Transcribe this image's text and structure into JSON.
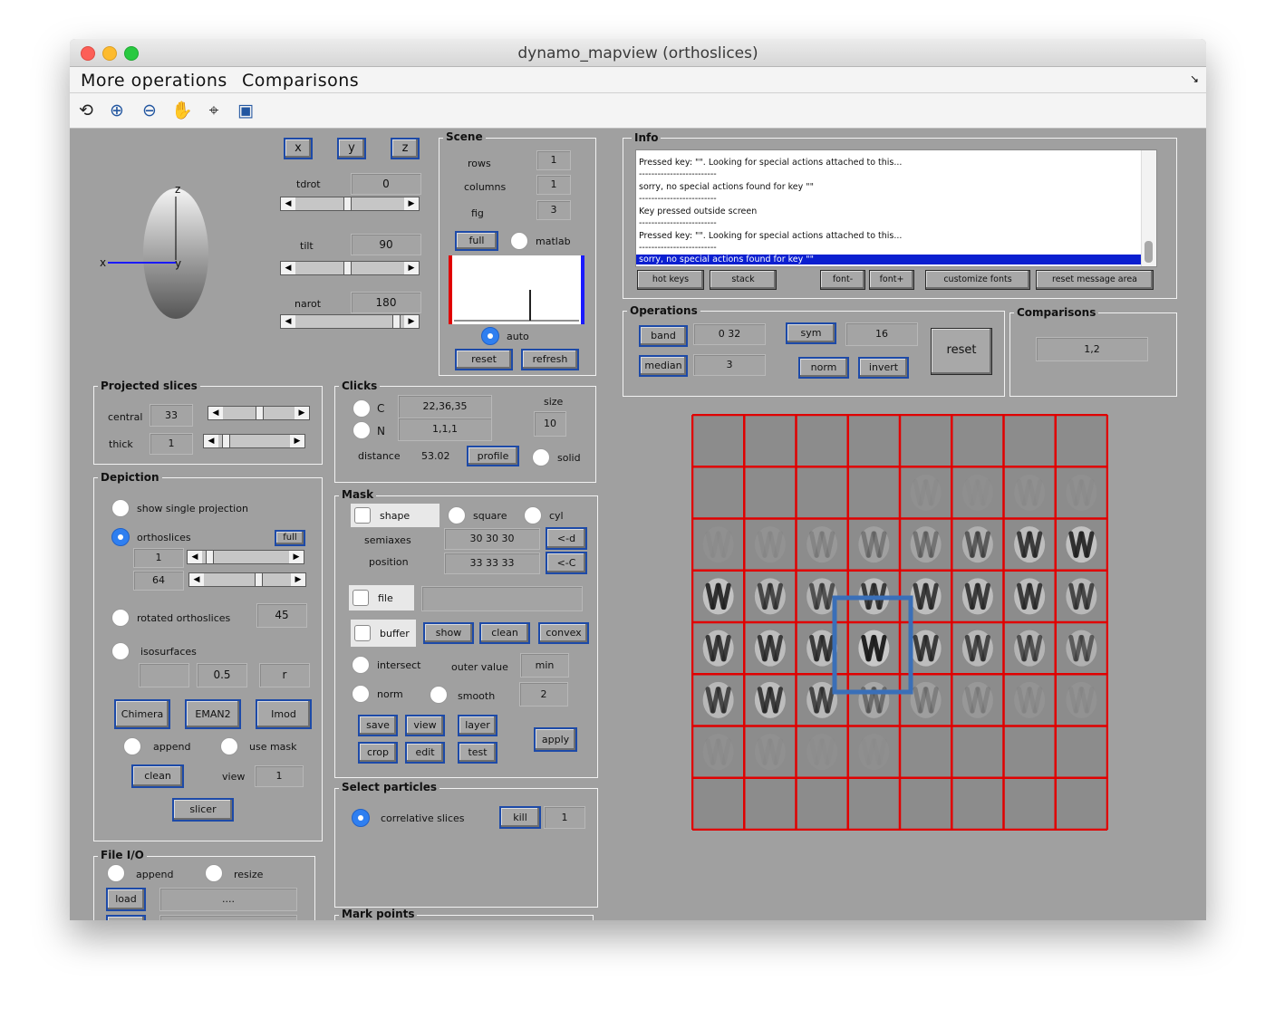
{
  "window": {
    "title": "dynamo_mapview (orthoslices)"
  },
  "menu": {
    "items": [
      "More operations",
      "Comparisons"
    ]
  },
  "toolbar": {
    "icons": [
      "rotate-3d-icon",
      "zoom-in-icon",
      "zoom-out-icon",
      "pan-hand-icon",
      "data-cursor-icon",
      "save-icon"
    ]
  },
  "axes_buttons": {
    "x": "x",
    "y": "y",
    "z": "z"
  },
  "orientation": {
    "z_label": "z",
    "x_label": "x",
    "y_label": "y",
    "tdrot": {
      "label": "tdrot",
      "value": "0",
      "slider": 0.5
    },
    "tilt": {
      "label": "tilt",
      "value": "90",
      "slider": 0.5
    },
    "narot": {
      "label": "narot",
      "value": "180",
      "slider": 1.0
    }
  },
  "scene": {
    "title": "Scene",
    "rows_label": "rows",
    "rows": "1",
    "columns_label": "columns",
    "columns": "1",
    "fig_label": "fig",
    "fig": "3",
    "full": "full",
    "matlab": "matlab",
    "auto": "auto",
    "reset": "reset",
    "refresh": "refresh"
  },
  "info": {
    "title": "Info",
    "lines": [
      "Pressed key: \"\".  Looking for special actions attached to this...",
      "-------------------------",
      "sorry, no special actions found for key \"\"",
      "-------------------------",
      "Key pressed outside screen",
      "-------------------------",
      "Pressed key: \"\".  Looking for special actions attached to this...",
      "-------------------------",
      "sorry, no special actions found for key \"\""
    ],
    "buttons": {
      "hot_keys": "hot keys",
      "stack": "stack",
      "font_minus": "font-",
      "font_plus": "font+",
      "customize": "customize fonts",
      "reset_area": "reset message area"
    }
  },
  "operations": {
    "title": "Operations",
    "band": "band",
    "band_value": "0  32",
    "median": "median",
    "median_value": "3",
    "sym": "sym",
    "sym_value": "16",
    "norm": "norm",
    "invert": "invert",
    "reset": "reset"
  },
  "comparisons": {
    "title": "Comparisons",
    "value": "1,2"
  },
  "projected": {
    "title": "Projected slices",
    "central_label": "central",
    "central": "33",
    "central_slider": 0.55,
    "thick_label": "thick",
    "thick": "1",
    "thick_slider": 0.05
  },
  "clicks": {
    "title": "Clicks",
    "c_label": "C",
    "c_value": "22,36,35",
    "n_label": "N",
    "n_value": "1,1,1",
    "size_label": "size",
    "size": "10",
    "distance_label": "distance",
    "distance": "53.02",
    "profile": "profile",
    "solid": "solid"
  },
  "depiction": {
    "title": "Depiction",
    "single": "show single projection",
    "orthoslices": "orthoslices",
    "full": "full",
    "s1": "1",
    "s1_slider": 0.1,
    "s2": "64",
    "s2_slider": 0.8,
    "rotated": "rotated orthoslices",
    "rotated_value": "45",
    "isosurfaces": "isosurfaces",
    "iso_value": "0.5",
    "iso_r": "r",
    "chimera": "Chimera",
    "eman2": "EMAN2",
    "imod": "Imod",
    "append": "append",
    "use_mask": "use mask",
    "clean": "clean",
    "view_label": "view",
    "view": "1",
    "slicer": "slicer"
  },
  "mask": {
    "title": "Mask",
    "shape": "shape",
    "square": "square",
    "cyl": "cyl",
    "semiaxes_label": "semiaxes",
    "semiaxes": "30  30  30",
    "position_label": "position",
    "position": "33  33  33",
    "d_btn": "<-d",
    "c_btn": "<-C",
    "file": "file",
    "file_value": "",
    "buffer": "buffer",
    "show": "show",
    "clean": "clean",
    "convex": "convex",
    "intersect": "intersect",
    "outer_label": "outer value",
    "outer": "min",
    "norm": "norm",
    "smooth": "smooth",
    "smooth_value": "2",
    "save": "save",
    "view": "view",
    "layer": "layer",
    "crop": "crop",
    "edit": "edit",
    "test": "test",
    "apply": "apply"
  },
  "select": {
    "title": "Select particles",
    "correlative": "correlative slices",
    "kill": "kill",
    "kill_value": "1"
  },
  "fileio": {
    "title": "File I/O",
    "append": "append",
    "resize": "resize",
    "load": "load",
    "path": "...."
  },
  "mark": {
    "title": "Mark points"
  },
  "colors": {
    "accent": "#2f7ff0",
    "grid_line": "#e00000",
    "selection_box": "#3a6fb8"
  }
}
